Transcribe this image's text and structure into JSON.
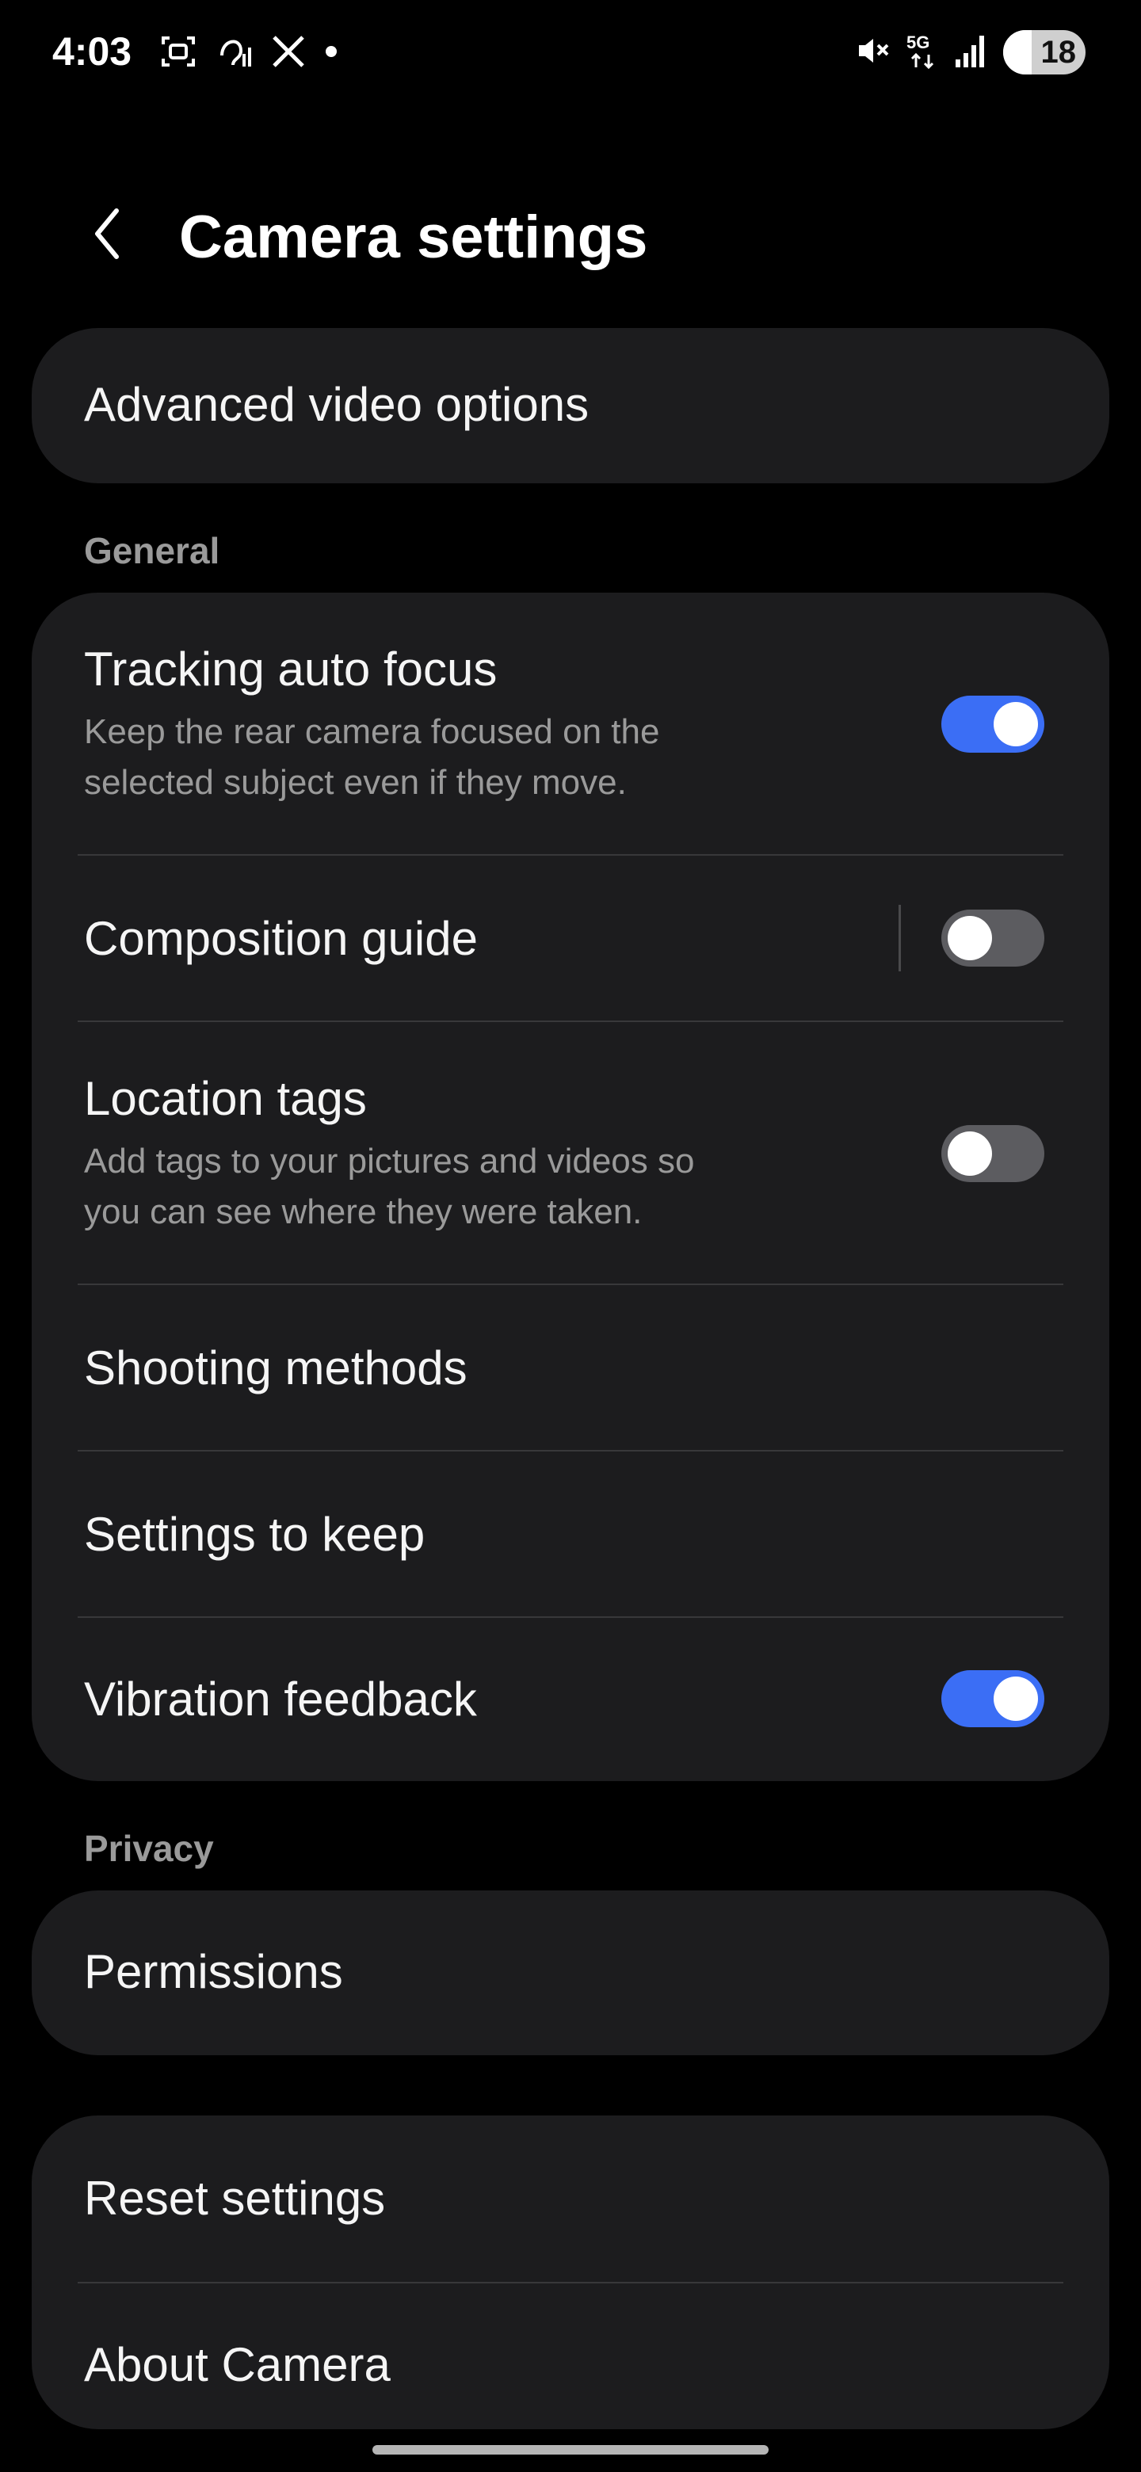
{
  "status_bar": {
    "time": "4:03",
    "left_icons": [
      "screenshot-icon",
      "hearing-icon",
      "x-app-icon",
      "notification-dot-icon"
    ],
    "right_icons": [
      "mute-icon",
      "5g-icon",
      "signal-icon"
    ],
    "network": "5G",
    "battery_level": "18"
  },
  "header": {
    "title": "Camera settings",
    "back_icon": "chevron-left-icon"
  },
  "advanced_video": {
    "label": "Advanced video options"
  },
  "general": {
    "section_label": "General",
    "items": [
      {
        "title": "Tracking auto focus",
        "subtitle_line1": "Keep the rear camera focused on the",
        "subtitle_line2": "selected subject even if they move.",
        "toggle": true
      },
      {
        "title": "Composition guide",
        "toggle": false
      },
      {
        "title": "Location tags",
        "subtitle_line1": "Add tags to your pictures and videos so",
        "subtitle_line2": "you can see where they were taken.",
        "toggle": false
      },
      {
        "title": "Shooting methods"
      },
      {
        "title": "Settings to keep"
      },
      {
        "title": "Vibration feedback",
        "toggle": true
      }
    ]
  },
  "privacy": {
    "section_label": "Privacy",
    "permissions_label": "Permissions"
  },
  "misc": {
    "reset_label": "Reset settings",
    "about_label": "About Camera"
  },
  "colors": {
    "background": "#000000",
    "card": "#1c1c1e",
    "toggle_on": "#3b6ef5",
    "toggle_off": "#5c5c60",
    "secondary_text": "#9a9a9a"
  }
}
